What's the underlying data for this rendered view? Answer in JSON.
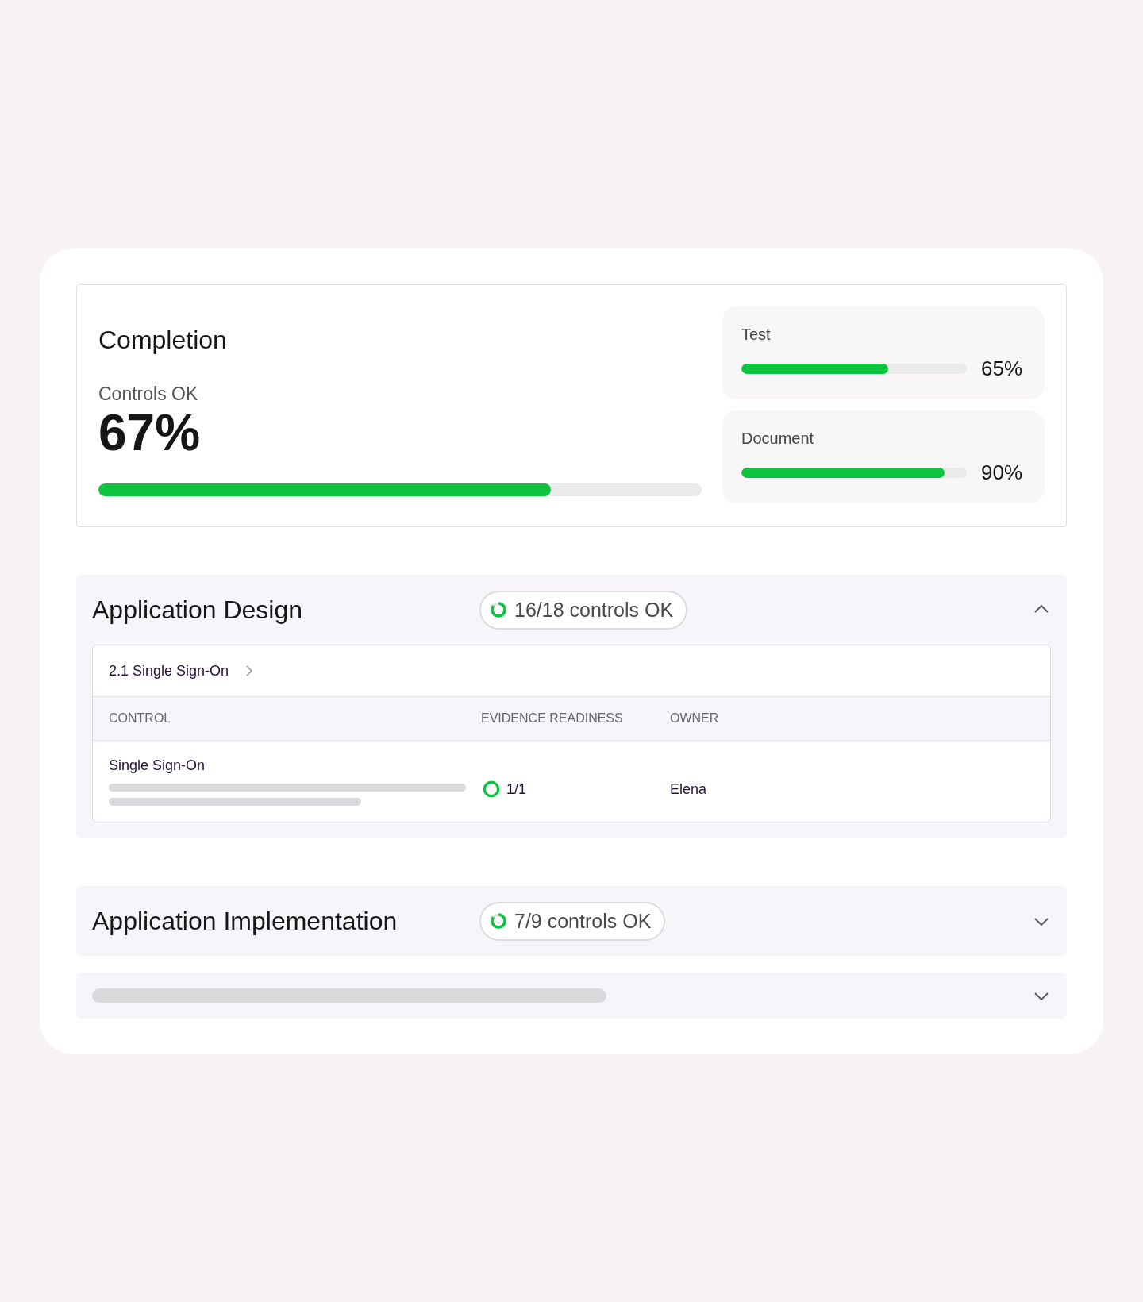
{
  "completion": {
    "title": "Completion",
    "label": "Controls OK",
    "value": "67%",
    "level": 0.75,
    "breakdown": [
      {
        "name": "Test",
        "level": 0.65,
        "reading": "65%"
      },
      {
        "name": "Document",
        "level": 0.9,
        "reading": "90%"
      }
    ]
  },
  "sections": [
    {
      "kind": "group",
      "title": "Application Design",
      "badge": "16/18 controls OK",
      "expanded": true,
      "table": {
        "breadcrumb": "2.1 Single Sign-On",
        "columns": [
          "CONTROL",
          "EVIDENCE READINESS",
          "OWNER"
        ],
        "rows": [
          {
            "control": "Single Sign-On",
            "evidence": "1/1",
            "owner": "Elena"
          }
        ]
      }
    },
    {
      "kind": "group",
      "title": "Application Implementation",
      "badge": "7/9 controls OK",
      "expanded": false
    },
    {
      "kind": "skeleton",
      "expanded": false
    }
  ]
}
